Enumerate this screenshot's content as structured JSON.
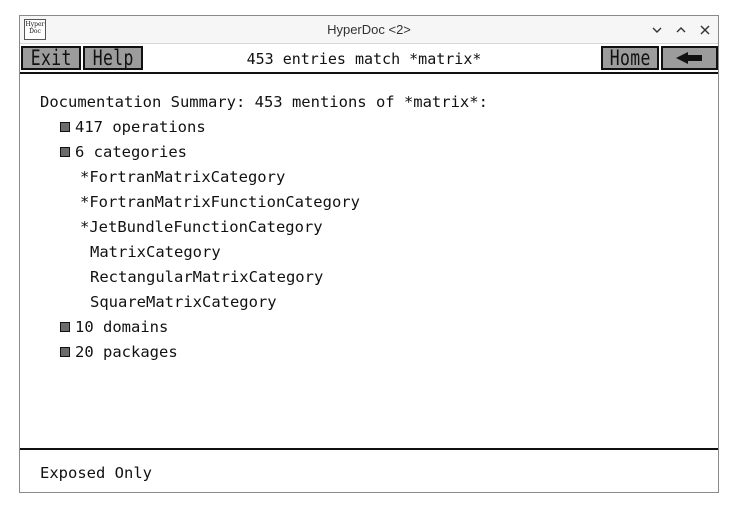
{
  "window": {
    "title": "HyperDoc <2>",
    "app_icon_text": [
      "Hyper",
      "Doc"
    ],
    "controls": [
      "minimize",
      "maximize",
      "close"
    ]
  },
  "toolbar": {
    "exit_label": "Exit",
    "help_label": "Help",
    "header": "453 entries match *matrix*",
    "home_label": "Home",
    "back_icon": "back-arrow-icon"
  },
  "summary": {
    "heading": "Documentation Summary: 453 mentions of *matrix*:",
    "operations": "417 operations",
    "categories": "6 categories",
    "category_items": [
      "*FortranMatrixCategory",
      "*FortranMatrixFunctionCategory",
      "*JetBundleFunctionCategory",
      "MatrixCategory",
      "RectangularMatrixCategory",
      "SquareMatrixCategory"
    ],
    "domains": "10 domains",
    "packages": "20 packages"
  },
  "footer": {
    "label": "Exposed Only"
  }
}
